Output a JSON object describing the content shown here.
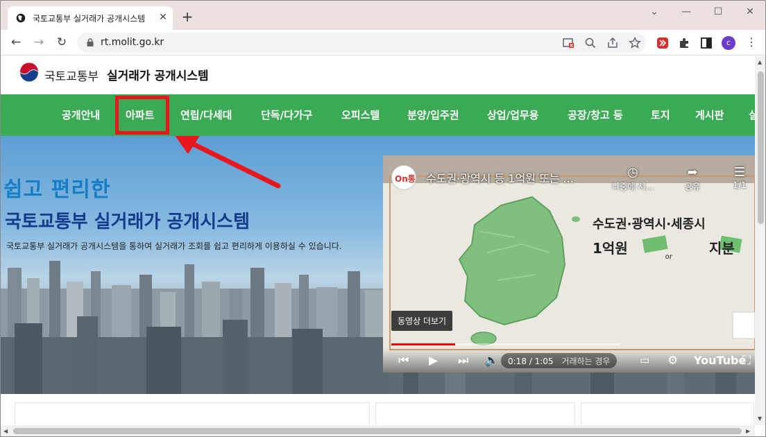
{
  "browser": {
    "tab_title": "국토교통부 실거래가 공개시스템",
    "url": "rt.molit.go.kr",
    "avatar_letter": "c",
    "window_controls": [
      "—",
      "☐",
      "✕"
    ]
  },
  "site": {
    "logo_ministry": "국토교통부",
    "logo_system": "실거래가 공개시스템",
    "nav": [
      "공개안내",
      "아파트",
      "연립/다세대",
      "단독/다가구",
      "오피스텔",
      "분양/입주권",
      "상업/업무용",
      "공장/창고 등",
      "토지",
      "게시판",
      "실"
    ],
    "highlighted_nav": "아파트",
    "accent_color": "#3aaa54",
    "highlight_color": "#e8161d"
  },
  "hero": {
    "title_line1": "쉽고 편리한",
    "title_line2": "국토교통부 실거래가 공개시스템",
    "description": "국토교통부 실거래가 공개시스템을 통하여 실거래가 조회를 쉽고 편리하게 이용하실 수 있습니다."
  },
  "video": {
    "title": "수도권·광역시 등 1억원 또는 ...",
    "watch_later": "나중에 시...",
    "share": "공유",
    "playlist_count": "1/1",
    "overlay_line1": "수도권·광역시·세종시",
    "overlay_line2a": "1억원",
    "overlay_or": "or",
    "overlay_line2b": "지분",
    "more_videos": "동영상 더보기",
    "time": "0:18 / 1:05",
    "chapter": "거래하는 경우",
    "progress": 0.28,
    "youtube_label": "YouTube",
    "channel_label": "On통"
  }
}
